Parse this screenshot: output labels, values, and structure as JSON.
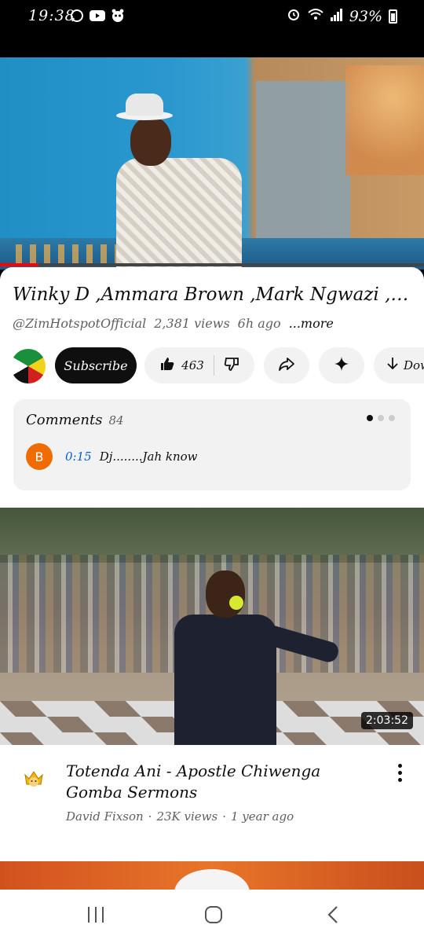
{
  "status_bar": {
    "time": "19:38",
    "left_icons": [
      "whatsapp-icon",
      "youtube-icon",
      "app-icon"
    ],
    "right_icons": [
      "alarm-icon",
      "wifi-icon",
      "signal-icon"
    ],
    "battery": "93%"
  },
  "player": {
    "progress_fraction": 0.09,
    "progress_color": "#ff0000"
  },
  "video": {
    "title": "Winky D ,Ammara Brown ,Mark Ngwazi ,Ma...",
    "channel_handle": "@ZimHotspotOfficial",
    "views": "2,381 views",
    "age": "6h ago",
    "more_label": "...more"
  },
  "actions": {
    "subscribe_label": "Subscribe",
    "like_count": "463",
    "download_label": "Dow"
  },
  "comments": {
    "label": "Comments",
    "count": "84",
    "top_comment": {
      "avatar_letter": "B",
      "avatar_color": "#ef6c00",
      "timestamp": "0:15",
      "text": "Dj........Jah know"
    }
  },
  "next_video": {
    "duration": "2:03:52",
    "title": "Totenda Ani - Apostle Chiwenga Gomba Sermons",
    "channel": "David Fixson",
    "views": "23K views",
    "age": "1 year ago",
    "separator": "·"
  }
}
